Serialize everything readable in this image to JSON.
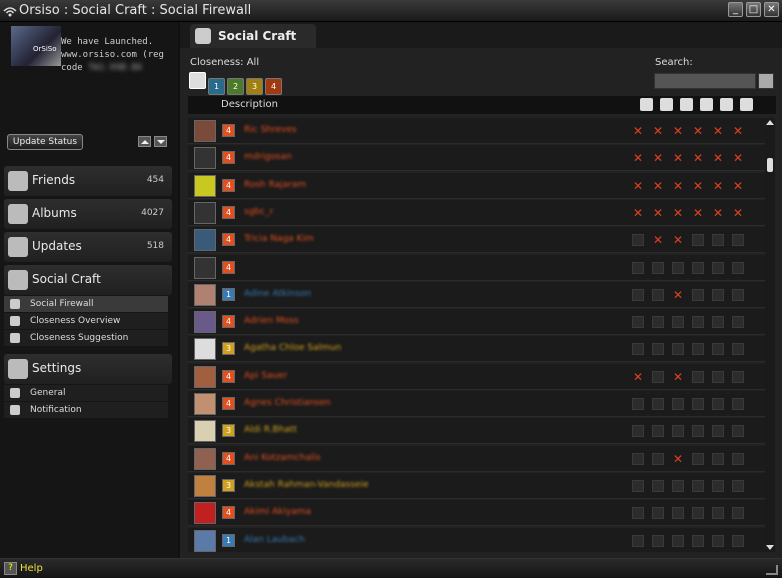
{
  "window": {
    "title": "Orsiso : Social Craft : Social Firewall",
    "controls": [
      "_",
      "□",
      "✕"
    ]
  },
  "status": {
    "avatar_label": "OrSiSo",
    "line1": "We have Launched.",
    "line2": "www.orsiso.com (reg",
    "line3": "code",
    "code": "TW1-99B-B6",
    "button": "Update Status"
  },
  "social_icons": [
    {
      "name": "linkedin-icon",
      "label": "in",
      "color": "#1f6fb5"
    },
    {
      "name": "flickr-icon",
      "label": "••",
      "color": "#1e4fb0"
    },
    {
      "name": "twitter-icon",
      "label": "t",
      "color": "#3aa0e0"
    },
    {
      "name": "myspace-icon",
      "label": "m",
      "color": "#3b8a3b"
    },
    {
      "name": "facebook-icon",
      "label": "f",
      "color": "#3b5998"
    },
    {
      "name": "blogger-icon",
      "label": "b",
      "color": "#e07a20"
    },
    {
      "name": "orsiso-icon",
      "label": "o",
      "color": "#dddddd"
    }
  ],
  "nav": {
    "friends": {
      "label": "Friends",
      "count": "454"
    },
    "albums": {
      "label": "Albums",
      "count": "4027"
    },
    "updates": {
      "label": "Updates",
      "count": "518"
    },
    "social_craft": {
      "label": "Social Craft",
      "items": [
        "Social Firewall",
        "Closeness Overview",
        "Closeness Suggestion"
      ]
    },
    "settings": {
      "label": "Settings",
      "items": [
        "General",
        "Notification"
      ]
    }
  },
  "tab": {
    "label": "Social Craft"
  },
  "closeness": {
    "label": "Closeness:",
    "value": "All",
    "buttons": [
      "",
      "1",
      "2",
      "3",
      "4"
    ]
  },
  "search": {
    "label": "Search:",
    "placeholder": ""
  },
  "table": {
    "description_header": "Description",
    "perm_icons": [
      "comment-icon",
      "exclamation-icon",
      "person-icon",
      "mail-icon",
      "calendar-icon",
      "photo-icon"
    ]
  },
  "rows": [
    {
      "name": "Ric Shreves",
      "level": "4",
      "color": "#e05020",
      "perms": [
        1,
        1,
        1,
        1,
        1,
        1
      ],
      "pic": "#7a4a3a"
    },
    {
      "name": "mdrigosan",
      "level": "4",
      "color": "#e05020",
      "perms": [
        1,
        1,
        1,
        1,
        1,
        1
      ],
      "pic": "#333333"
    },
    {
      "name": "Rosh Rajaram",
      "level": "4",
      "color": "#e05020",
      "perms": [
        1,
        1,
        1,
        1,
        1,
        1
      ],
      "pic": "#c8c820"
    },
    {
      "name": "sgbc_r",
      "level": "4",
      "color": "#e05020",
      "perms": [
        1,
        1,
        1,
        1,
        1,
        1
      ],
      "pic": "#333333"
    },
    {
      "name": "Tricia Naga Kim",
      "level": "4",
      "color": "#e05020",
      "perms": [
        0,
        1,
        1,
        0,
        0,
        0
      ],
      "pic": "#3a5a7a"
    },
    {
      "name": "",
      "level": "4",
      "color": "#e05020",
      "perms": [
        0,
        0,
        0,
        0,
        0,
        0
      ],
      "pic": "#333333"
    },
    {
      "name": "Adine Atkinson",
      "level": "1",
      "color": "#3a7ab0",
      "perms": [
        0,
        0,
        1,
        0,
        0,
        0
      ],
      "pic": "#b08070"
    },
    {
      "name": "Adrien Moss",
      "level": "4",
      "color": "#e05020",
      "perms": [
        0,
        0,
        0,
        0,
        0,
        0
      ],
      "pic": "#6a5a8a"
    },
    {
      "name": "Agatha Chloe Salmun",
      "level": "3",
      "color": "#d0a020",
      "perms": [
        0,
        0,
        0,
        0,
        0,
        0
      ],
      "pic": "#dddddd"
    },
    {
      "name": "Api Sauer",
      "level": "4",
      "color": "#e05020",
      "perms": [
        1,
        0,
        1,
        0,
        0,
        0
      ],
      "pic": "#a06040"
    },
    {
      "name": "Agnes Christiansen",
      "level": "4",
      "color": "#e05020",
      "perms": [
        0,
        0,
        0,
        0,
        0,
        0
      ],
      "pic": "#c09070"
    },
    {
      "name": "Aldi R.Bhatt",
      "level": "3",
      "color": "#d0a020",
      "perms": [
        0,
        0,
        0,
        0,
        0,
        0
      ],
      "pic": "#d8d0b0"
    },
    {
      "name": "Ani Kotzamchalis",
      "level": "4",
      "color": "#e05020",
      "perms": [
        0,
        0,
        1,
        0,
        0,
        0
      ],
      "pic": "#906050"
    },
    {
      "name": "Akstah Rahman-Vandasseie",
      "level": "3",
      "color": "#d0a020",
      "perms": [
        0,
        0,
        0,
        0,
        0,
        0
      ],
      "pic": "#c08040"
    },
    {
      "name": "Akimi Akiyama",
      "level": "4",
      "color": "#e05020",
      "perms": [
        0,
        0,
        0,
        0,
        0,
        0
      ],
      "pic": "#c02020"
    },
    {
      "name": "Alan Laubach",
      "level": "1",
      "color": "#3a7ab0",
      "perms": [
        0,
        0,
        0,
        0,
        0,
        0
      ],
      "pic": "#5a7aaa"
    }
  ],
  "footer": {
    "help": "Help"
  }
}
